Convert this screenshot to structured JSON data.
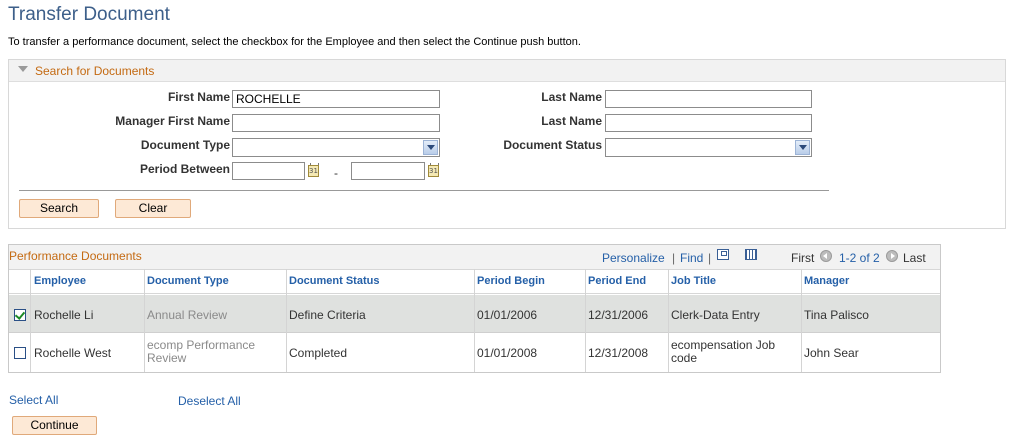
{
  "page": {
    "title": "Transfer Document",
    "instructions": "To transfer a performance document, select the checkbox for the Employee and then select the Continue push button."
  },
  "search": {
    "title": "Search for Documents",
    "first_name_label": "First Name",
    "first_name_value": "ROCHELLE",
    "last_name_label": "Last Name",
    "last_name_value": "",
    "manager_first_name_label": "Manager First Name",
    "manager_first_name_value": "",
    "manager_last_name_label": "Last Name",
    "manager_last_name_value": "",
    "document_type_label": "Document Type",
    "document_type_value": "",
    "document_status_label": "Document Status",
    "document_status_value": "",
    "period_between_label": "Period Between",
    "period_from_value": "",
    "period_to_value": "",
    "period_separator": "-",
    "calendar_glyph": "31",
    "search_button": "Search",
    "clear_button": "Clear"
  },
  "grid": {
    "title": "Performance Documents",
    "nav": {
      "personalize": "Personalize",
      "separator": "|",
      "find": "Find",
      "first": "First",
      "range": "1-2 of 2",
      "last": "Last"
    },
    "columns": [
      "Employee",
      "Document Type",
      "Document Status",
      "Period Begin",
      "Period End",
      "Job Title",
      "Manager"
    ],
    "rows": [
      {
        "checked": true,
        "employee": "Rochelle Li",
        "document_type": "Annual Review",
        "document_status": "Define Criteria",
        "period_begin": "01/01/2006",
        "period_end": "12/31/2006",
        "job_title": "Clerk-Data Entry",
        "manager": "Tina Palisco"
      },
      {
        "checked": false,
        "employee": "Rochelle West",
        "document_type": "ecomp Performance Review",
        "document_status": "Completed",
        "period_begin": "01/01/2008",
        "period_end": "12/31/2008",
        "job_title": "ecompensation Job code",
        "manager": "John Sear"
      }
    ]
  },
  "footer": {
    "select_all": "Select All",
    "deselect_all": "Deselect All",
    "continue_button": "Continue"
  },
  "colors": {
    "title_blue": "#3d5f8a",
    "section_orange": "#c46a12",
    "link_blue": "#2560a8",
    "button_fill": "#fde9d6",
    "selected_row": "#dfe1df"
  },
  "icons": {
    "collapse": "triangle-down-icon",
    "calendar": "calendar-icon",
    "dropdown": "chevron-down-icon",
    "zoom": "zoom-icon",
    "download": "download-icon",
    "prev": "arrow-left-icon",
    "next": "arrow-right-icon"
  }
}
